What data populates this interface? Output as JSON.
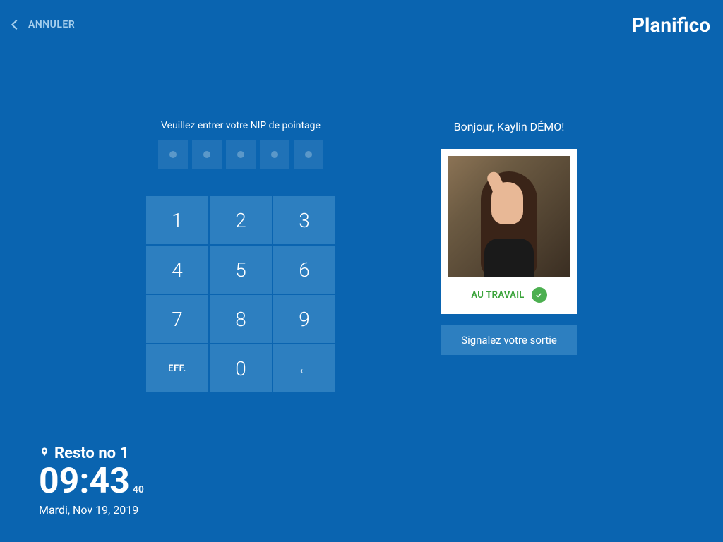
{
  "header": {
    "cancel_label": "ANNULER",
    "brand": "Planifico"
  },
  "keypad": {
    "instruction": "Veuillez entrer votre NIP de pointage",
    "pin_length": 5,
    "keys": [
      "1",
      "2",
      "3",
      "4",
      "5",
      "6",
      "7",
      "8",
      "9"
    ],
    "clear_label": "EFF.",
    "zero_label": "0",
    "backspace_glyph": "←"
  },
  "user": {
    "greeting": "Bonjour, Kaylin DÉMO!",
    "status_label": "AU TRAVAIL",
    "signout_label": "Signalez votre sortie"
  },
  "footer": {
    "location": "Resto no 1",
    "time_hhmm": "09:43",
    "time_ss": "40",
    "date": "Mardi, Nov 19, 2019"
  }
}
